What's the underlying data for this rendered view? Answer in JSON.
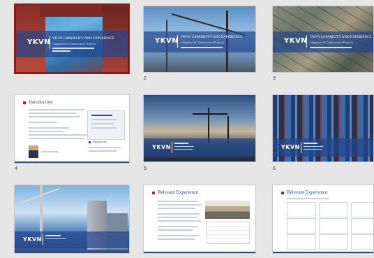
{
  "slides": [
    {
      "number": "",
      "logo": "YKVN",
      "title": "YKVN CAPABILITY AND EXPERIENCE",
      "subtitle": "Litigation in Construction Projects"
    },
    {
      "number": "2",
      "logo": "YKVN",
      "title": "YKVN CAPABILITY AND EXPERIENCE",
      "subtitle": "Litigation in Construction Projects"
    },
    {
      "number": "3",
      "logo": "YKVN",
      "title": "YKVN CAPABILITY AND EXPERIENCE",
      "subtitle": "Litigation in Construction Projects"
    },
    {
      "number": "4",
      "heading": "Introduction",
      "side_heading": "Operations"
    },
    {
      "number": "5",
      "logo": "YKVN"
    },
    {
      "number": "6",
      "logo": "YKVN"
    },
    {
      "number": "",
      "logo": "YKVN"
    },
    {
      "number": "",
      "heading": "Relevant Experience"
    },
    {
      "number": "",
      "heading": "Relevant Experience"
    }
  ],
  "colors": {
    "selected_border": "#8b1b1b",
    "brand_blue": "#2a4c8a",
    "accent_red": "#c81e1e"
  }
}
